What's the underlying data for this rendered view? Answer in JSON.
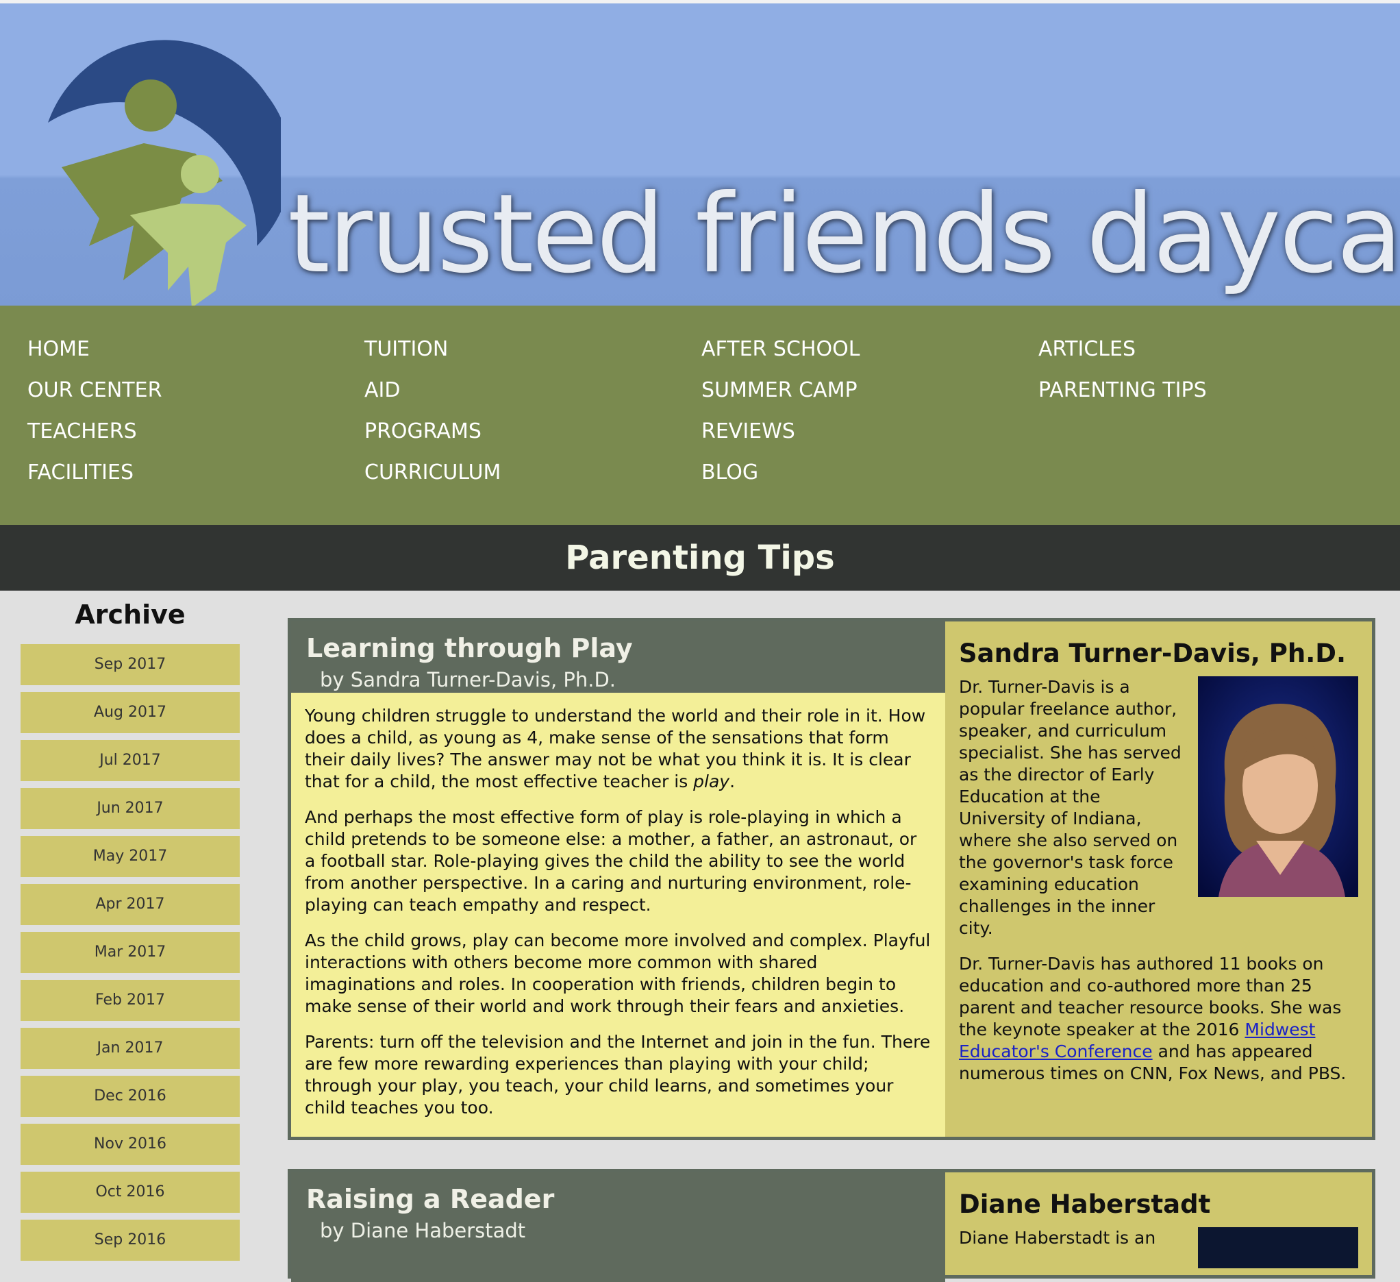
{
  "brand": {
    "name": "trusted friends daycare"
  },
  "nav": {
    "col1": [
      "HOME",
      "OUR CENTER",
      "TEACHERS",
      "FACILITIES"
    ],
    "col2": [
      "TUITION",
      "AID",
      "PROGRAMS",
      "CURRICULUM"
    ],
    "col3": [
      "AFTER SCHOOL",
      "SUMMER CAMP",
      "REVIEWS",
      "BLOG"
    ],
    "col4": [
      "ARTICLES",
      "PARENTING TIPS"
    ]
  },
  "page_title": "Parenting Tips",
  "archive": {
    "title": "Archive",
    "items": [
      "Sep 2017",
      "Aug 2017",
      "Jul 2017",
      "Jun 2017",
      "May 2017",
      "Apr 2017",
      "Mar 2017",
      "Feb 2017",
      "Jan 2017",
      "Dec 2016",
      "Nov 2016",
      "Oct 2016",
      "Sep 2016"
    ]
  },
  "articles": [
    {
      "title": "Learning through Play",
      "byline": "by Sandra Turner-Davis, Ph.D.",
      "p1_a": "Young children struggle to understand the world and their role in it. How does a child, as young as 4, make sense of the sensations that form their daily lives? The answer may not be what you think it is. It is clear that for a child, the most effective teacher is ",
      "p1_em": "play",
      "p1_b": ".",
      "p2": "And perhaps the most effective form of play is role-playing in which a child pretends to be someone else: a mother, a father, an astronaut, or a football star. Role-playing gives the child the ability to see the world from another perspective. In a caring and nurturing environment, role-playing can teach empathy and respect.",
      "p3": "As the child grows, play can become more involved and complex. Playful interactions with others become more common with shared imaginations and roles. In cooperation with friends, children begin to make sense of their world and work through their fears and anxieties.",
      "p4": "Parents: turn off the television and the Internet and join in the fun. There are few more rewarding experiences than playing with your child; through your play, you teach, your child learns, and sometimes your child teaches you too.",
      "author": {
        "name": "Sandra Turner-Davis, Ph.D.",
        "bio1": "Dr. Turner-Davis is a popular freelance author, speaker, and curriculum specialist. She has served as the director of Early Education at the University of Indiana, where she also served on the governor's task force examining education challenges in the inner city.",
        "bio2_a": "Dr. Turner-Davis has authored 11 books on education and co-authored more than 25 parent and teacher resource books. She was the keynote speaker at the 2016 ",
        "bio2_link": "Midwest Educator's Conference",
        "bio2_b": " and has appeared numerous times on CNN, Fox News, and PBS."
      }
    },
    {
      "title": "Raising a Reader",
      "byline": "by Diane Haberstadt",
      "author": {
        "name": "Diane Haberstadt",
        "bio1": "Diane Haberstadt is an"
      }
    }
  ]
}
